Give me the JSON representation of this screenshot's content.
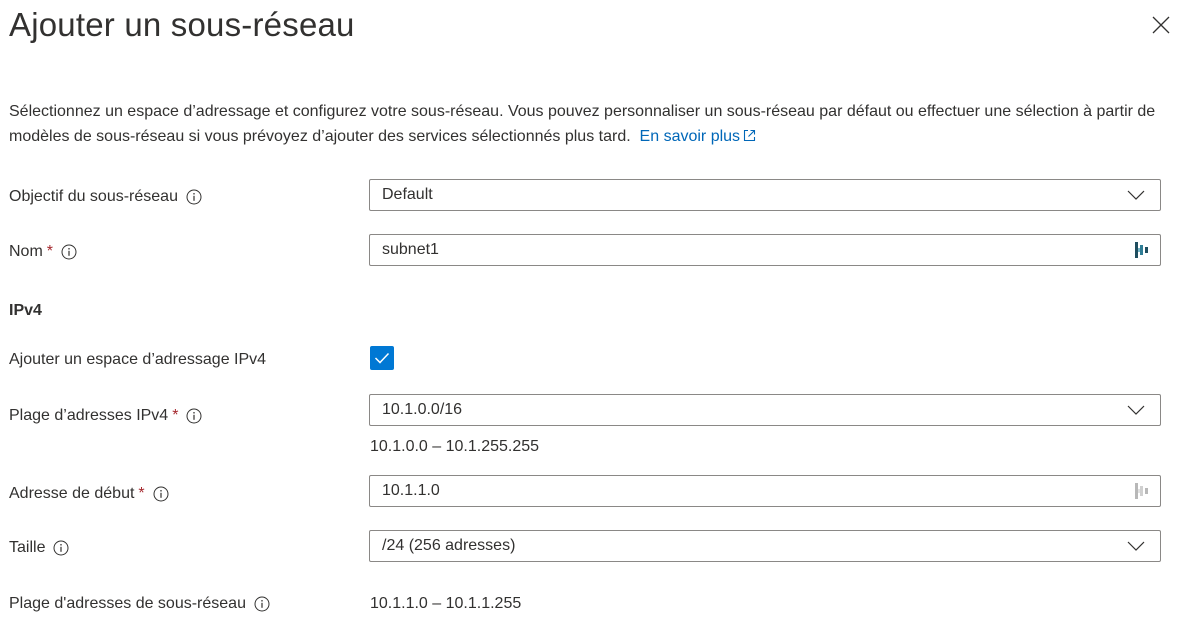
{
  "panel": {
    "title": "Ajouter un sous-réseau",
    "close_icon": "close-icon"
  },
  "description": {
    "text": "Sélectionnez un espace d’adressage et configurez votre sous-réseau. Vous pouvez personnaliser un sous-réseau par défaut ou effectuer une sélection à partir de modèles de sous-réseau si vous prévoyez d’ajouter des services sélectionnés plus tard.",
    "link_label": "En savoir plus",
    "link_icon": "external-link-icon"
  },
  "form": {
    "purpose": {
      "label": "Objectif du sous-réseau",
      "value": "Default"
    },
    "name": {
      "label": "Nom",
      "required_mark": "*",
      "value": "subnet1"
    },
    "ipv4_section": "IPv4",
    "add_ipv4": {
      "label": "Ajouter un espace d’adressage IPv4",
      "checked": true
    },
    "ipv4_range": {
      "label": "Plage d’adresses IPv4",
      "required_mark": "*",
      "value": "10.1.0.0/16",
      "range_text": "10.1.0.0 – 10.1.255.255"
    },
    "start_address": {
      "label": "Adresse de début",
      "required_mark": "*",
      "value": "10.1.1.0"
    },
    "size": {
      "label": "Taille",
      "value": "/24 (256 adresses)"
    },
    "subnet_range": {
      "label": "Plage d'adresses de sous-réseau",
      "value": "10.1.1.0 – 10.1.1.255"
    }
  },
  "colors": {
    "accent": "#0078d4",
    "link": "#0067b8",
    "required": "#a4262c",
    "text": "#323130",
    "border": "#8a8886"
  }
}
